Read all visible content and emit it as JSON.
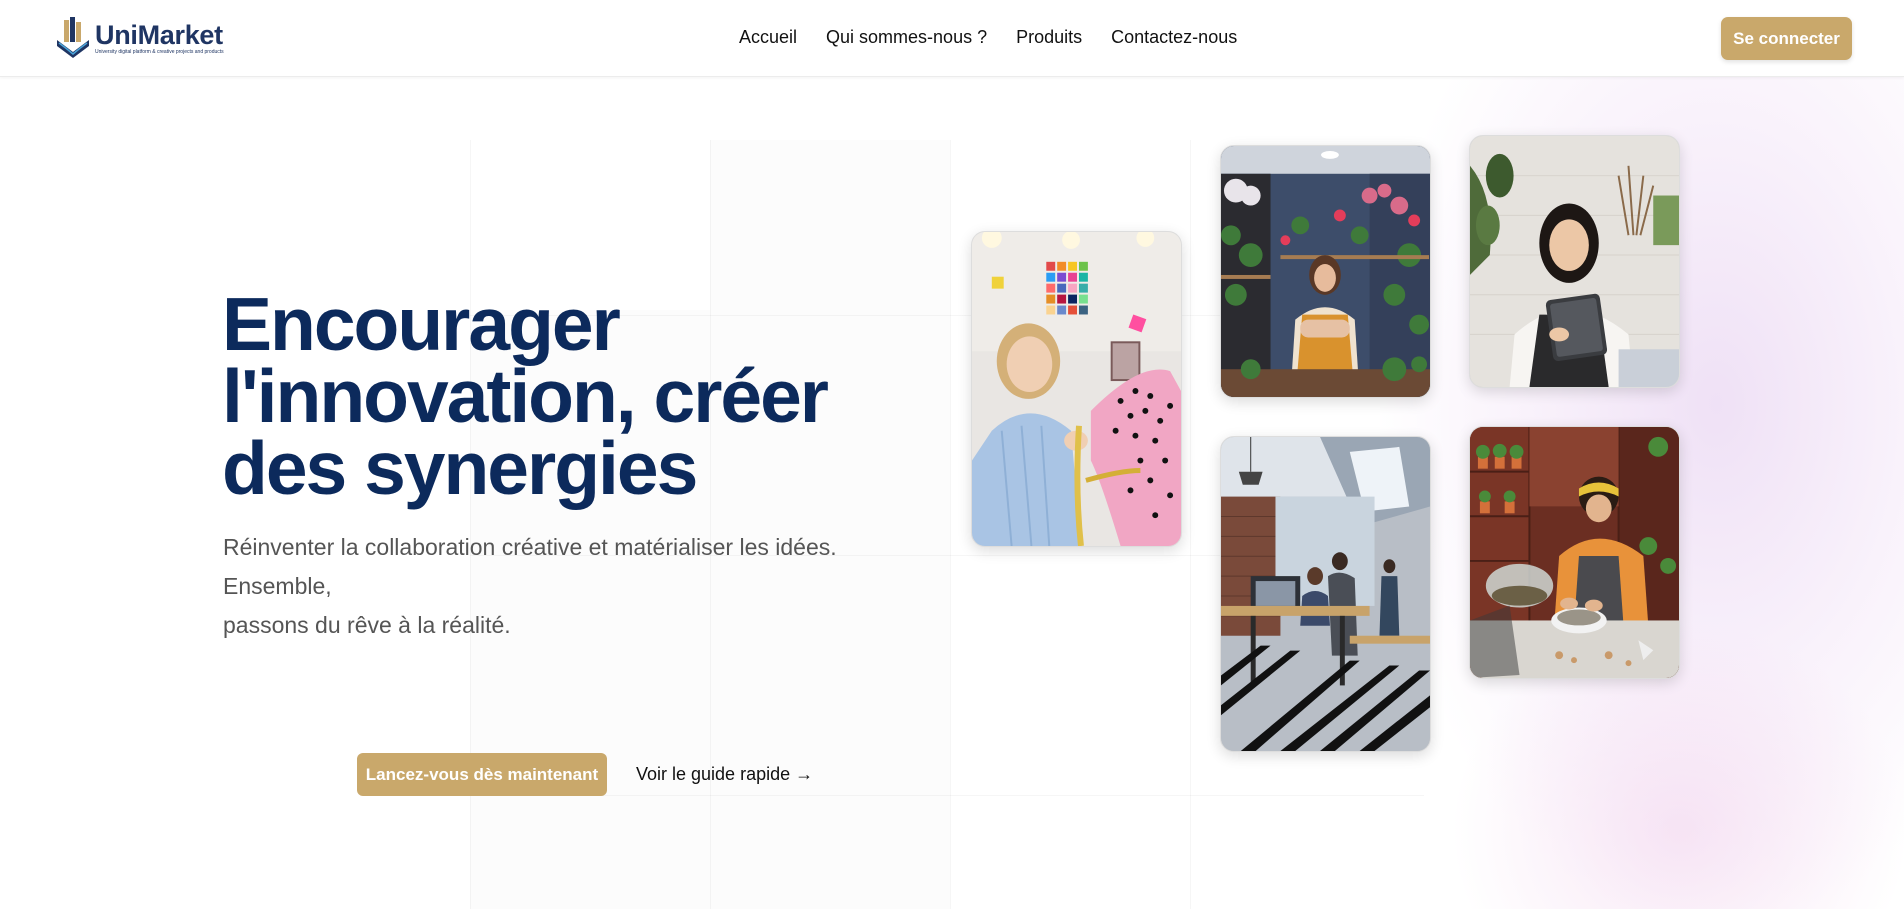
{
  "brand": {
    "name": "UniMarket",
    "tagline": "University digital platform & creative projects and products"
  },
  "nav": {
    "items": [
      {
        "label": "Accueil"
      },
      {
        "label": "Qui sommes-nous ?"
      },
      {
        "label": "Produits"
      },
      {
        "label": "Contactez-nous"
      }
    ],
    "login_label": "Se connecter"
  },
  "hero": {
    "title_lines": [
      "Encourager",
      "l'innovation, créer",
      "des synergies"
    ],
    "subtitle_lines": [
      "Réinventer la collaboration créative et matérialiser les idées. Ensemble,",
      "passons du rêve à la réalité."
    ],
    "cta_label": "Lancez-vous dès maintenant",
    "guide_label": "Voir le guide rapide →"
  },
  "photos": [
    {
      "icon": "fashion-designer-photo"
    },
    {
      "icon": "florist-shop-photo"
    },
    {
      "icon": "woman-with-tablet-photo"
    },
    {
      "icon": "coworking-office-photo"
    },
    {
      "icon": "terrarium-artisan-photo"
    }
  ],
  "colors": {
    "accent": "#c9a86b",
    "title": "#0c2a5c",
    "brand": "#1f3563"
  }
}
